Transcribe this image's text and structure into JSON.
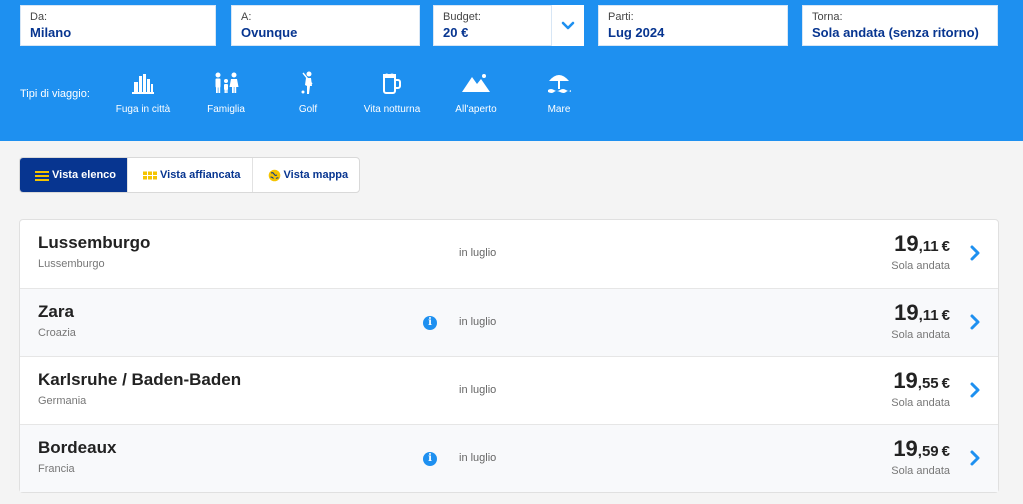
{
  "search": {
    "from": {
      "label": "Da:",
      "value": "Milano"
    },
    "to": {
      "label": "A:",
      "value": "Ovunque"
    },
    "budget": {
      "label": "Budget:",
      "value": "20 €"
    },
    "depart": {
      "label": "Parti:",
      "value": "Lug 2024"
    },
    "return": {
      "label": "Torna:",
      "value": "Sola andata (senza ritorno)"
    }
  },
  "trip_types": {
    "label": "Tipi di viaggio:",
    "items": [
      {
        "label": "Fuga in città",
        "icon": "city-icon"
      },
      {
        "label": "Famiglia",
        "icon": "family-icon"
      },
      {
        "label": "Golf",
        "icon": "golf-icon"
      },
      {
        "label": "Vita notturna",
        "icon": "nightlife-icon"
      },
      {
        "label": "All'aperto",
        "icon": "outdoors-icon"
      },
      {
        "label": "Mare",
        "icon": "beach-icon"
      }
    ]
  },
  "views": [
    {
      "label": "Vista elenco",
      "active": true
    },
    {
      "label": "Vista affiancata",
      "active": false
    },
    {
      "label": "Vista mappa",
      "active": false
    }
  ],
  "results": [
    {
      "city": "Lussemburgo",
      "country": "Lussemburgo",
      "info": false,
      "when": "in luglio",
      "price_int": "19",
      "price_dec": ",11",
      "currency": "€",
      "note": "Sola andata"
    },
    {
      "city": "Zara",
      "country": "Croazia",
      "info": true,
      "when": "in luglio",
      "price_int": "19",
      "price_dec": ",11",
      "currency": "€",
      "note": "Sola andata"
    },
    {
      "city": "Karlsruhe / Baden-Baden",
      "country": "Germania",
      "info": false,
      "when": "in luglio",
      "price_int": "19",
      "price_dec": ",55",
      "currency": "€",
      "note": "Sola andata"
    },
    {
      "city": "Bordeaux",
      "country": "Francia",
      "info": true,
      "when": "in luglio",
      "price_int": "19",
      "price_dec": ",59",
      "currency": "€",
      "note": "Sola andata"
    }
  ],
  "colors": {
    "header": "#1e90f0",
    "brand": "#073590",
    "accent": "#f5c400"
  }
}
